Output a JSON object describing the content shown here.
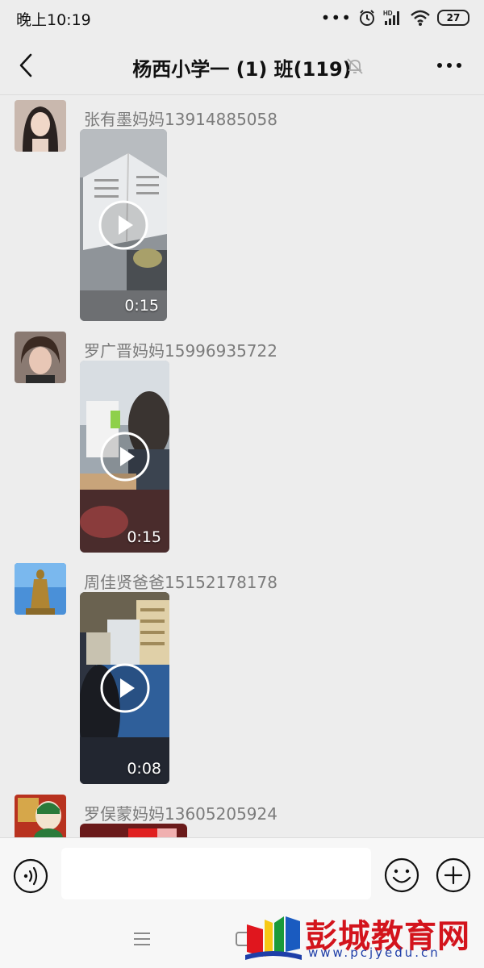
{
  "status_bar": {
    "time": "晚上10:19",
    "battery": "27",
    "hd_label": "HD",
    "icons": [
      "dots-icon",
      "alarm-icon",
      "signal-icon",
      "wifi-icon",
      "battery-icon"
    ]
  },
  "header": {
    "title": "杨西小学一 (1) 班(119)",
    "back_icon": "back-arrow-icon",
    "mute_icon": "muted-bell-icon",
    "more_icon": "more-dots-icon"
  },
  "messages": [
    {
      "sender": "张有墨妈妈13914885058",
      "type": "video",
      "duration": "0:15"
    },
    {
      "sender": "罗广晋妈妈15996935722",
      "type": "video",
      "duration": "0:15"
    },
    {
      "sender": "周佳贤爸爸15152178178",
      "type": "video",
      "duration": "0:08"
    },
    {
      "sender": "罗俣蒙妈妈13605205924",
      "type": "video",
      "duration": ""
    }
  ],
  "input_bar": {
    "placeholder": "",
    "voice_icon": "voice-icon",
    "emoji_icon": "emoji-icon",
    "plus_icon": "plus-icon"
  },
  "watermark": {
    "title": "彭城教育网",
    "url": "www.pcjyedu.cn"
  },
  "colors": {
    "background": "#ededed",
    "sender_text": "#7b7b7b",
    "watermark_red": "#d3141c",
    "watermark_blue": "#1e3ea8"
  }
}
